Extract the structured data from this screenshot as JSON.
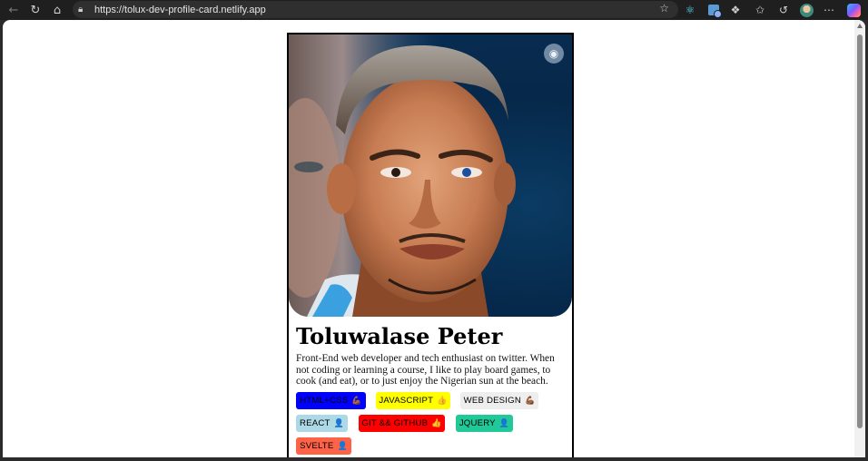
{
  "browser": {
    "url": "https://tolux-dev-profile-card.netlify.app",
    "nav_icons": [
      "back-icon",
      "reload-icon",
      "home-icon"
    ],
    "extension_icons": [
      "react-devtools-icon",
      "devtools-extension-icon",
      "extensions-puzzle-icon",
      "favorites-icon",
      "history-icon",
      "more-menu-icon",
      "profile-avatar",
      "copilot-icon"
    ]
  },
  "profile": {
    "name": "Toluwalase Peter",
    "bio": "Front-End web developer and tech enthusiast on twitter. When not coding or learning a course, I like to play board games, to cook (and eat), or to just enjoy the Nigerian sun at the beach.",
    "skills": [
      {
        "label": "HTML+CSS",
        "emoji": "💪🏾",
        "bg": "#0000ff",
        "fg": "#000000"
      },
      {
        "label": "JAVASCRIPT",
        "emoji": "👍",
        "bg": "#ffff00",
        "fg": "#000000"
      },
      {
        "label": "WEB DESIGN",
        "emoji": "💪🏾",
        "bg": "#eeeeee",
        "fg": "#000000"
      },
      {
        "label": "REACT",
        "emoji": "👤",
        "bg": "#add8e6",
        "fg": "#000000"
      },
      {
        "label": "GIT && GITHUB",
        "emoji": "👍",
        "bg": "#ff0000",
        "fg": "#000000"
      },
      {
        "label": "JQUERY",
        "emoji": "👤",
        "bg": "#20c997",
        "fg": "#000000"
      },
      {
        "label": "SVELTE",
        "emoji": "👤",
        "bg": "#ff6347",
        "fg": "#000000"
      }
    ]
  }
}
